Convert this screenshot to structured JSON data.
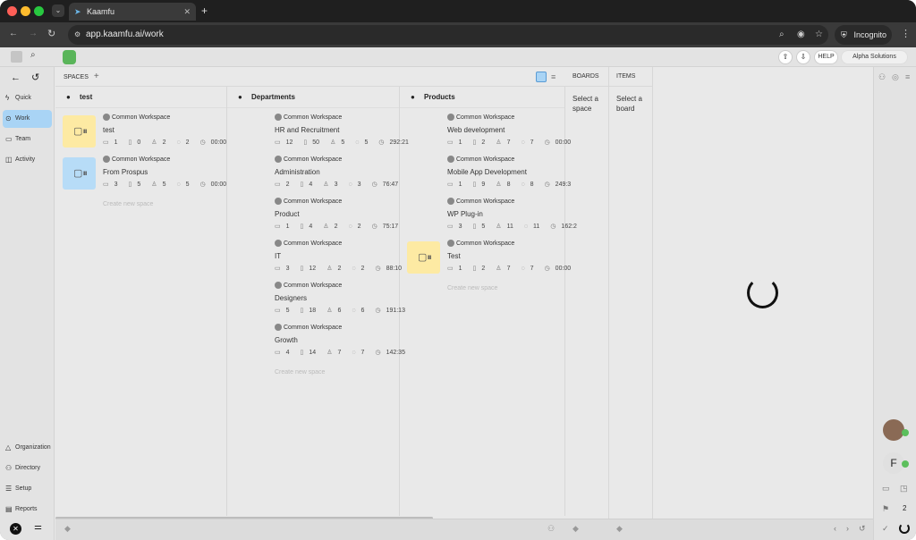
{
  "browser": {
    "tab_title": "Kaamfu",
    "url": "app.kaamfu.ai/work",
    "incognito_label": "Incognito",
    "colors": {
      "close": "#fe5f57",
      "min": "#febc2e",
      "max": "#28c840"
    }
  },
  "toolbar": {
    "help_label": "HELP",
    "org_label": "Alpha Solutions"
  },
  "nav": {
    "items": [
      {
        "label": "Quick",
        "icon": "bolt-icon"
      },
      {
        "label": "Work",
        "icon": "pin-icon"
      },
      {
        "label": "Team",
        "icon": "team-icon"
      },
      {
        "label": "Activity",
        "icon": "activity-icon"
      }
    ],
    "bottom": [
      {
        "label": "Organization",
        "icon": "organization-icon"
      },
      {
        "label": "Directory",
        "icon": "directory-icon"
      },
      {
        "label": "Setup",
        "icon": "setup-icon"
      },
      {
        "label": "Reports",
        "icon": "reports-icon"
      }
    ]
  },
  "spaces": {
    "header": "SPACES",
    "add_symbol": "+",
    "create_label": "Create new space",
    "columns": [
      {
        "title": "test",
        "items": [
          {
            "workspace": "Common Workspace",
            "name": "test",
            "color": "#fdeaa3",
            "stats": [
              "1",
              "0",
              "2",
              "2",
              "00:00"
            ]
          },
          {
            "workspace": "Common Workspace",
            "name": "From Prospus",
            "color": "#b7dcf7",
            "stats": [
              "3",
              "5",
              "5",
              "5",
              "00:00"
            ]
          }
        ]
      },
      {
        "title": "Departments",
        "items": [
          {
            "workspace": "Common Workspace",
            "name": "HR and Recruitment",
            "color": "",
            "stats": [
              "12",
              "50",
              "5",
              "5",
              "292:21"
            ]
          },
          {
            "workspace": "Common Workspace",
            "name": "Administration",
            "color": "",
            "stats": [
              "2",
              "4",
              "3",
              "3",
              "76:47"
            ]
          },
          {
            "workspace": "Common Workspace",
            "name": "Product",
            "color": "",
            "stats": [
              "1",
              "4",
              "2",
              "2",
              "75:17"
            ]
          },
          {
            "workspace": "Common Workspace",
            "name": "IT",
            "color": "",
            "stats": [
              "3",
              "12",
              "2",
              "2",
              "88:10"
            ]
          },
          {
            "workspace": "Common Workspace",
            "name": "Designers",
            "color": "",
            "stats": [
              "5",
              "18",
              "6",
              "6",
              "191:13"
            ]
          },
          {
            "workspace": "Common Workspace",
            "name": "Growth",
            "color": "",
            "stats": [
              "4",
              "14",
              "7",
              "7",
              "142:35"
            ]
          }
        ]
      },
      {
        "title": "Products",
        "items": [
          {
            "workspace": "Common Workspace",
            "name": "Web development",
            "color": "",
            "stats": [
              "1",
              "2",
              "7",
              "7",
              "00:00"
            ]
          },
          {
            "workspace": "Common Workspace",
            "name": "Mobile App Development",
            "color": "",
            "stats": [
              "1",
              "9",
              "8",
              "8",
              "249:3"
            ]
          },
          {
            "workspace": "Common Workspace",
            "name": "WP Plug-in",
            "color": "",
            "stats": [
              "3",
              "5",
              "11",
              "11",
              "162:2"
            ]
          },
          {
            "workspace": "Common Workspace",
            "name": "Test",
            "color": "#fdeaa3",
            "stats": [
              "1",
              "2",
              "7",
              "7",
              "00:00"
            ]
          }
        ]
      }
    ]
  },
  "boards": {
    "header": "BOARDS",
    "placeholder": "Select a space"
  },
  "items": {
    "header": "ITEMS",
    "placeholder": "Select a board"
  },
  "right": {
    "avatar_letter": "F",
    "flag_count": "2"
  }
}
